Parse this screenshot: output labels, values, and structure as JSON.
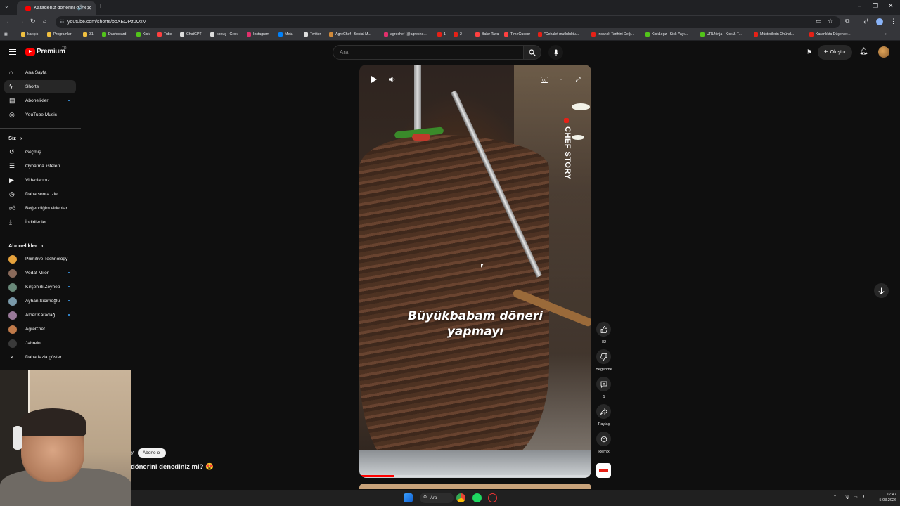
{
  "browser": {
    "tab_title": "Karadeniz dönerini denedin",
    "url": "youtube.com/shorts/boXEOPz0OxM",
    "bookmarks": [
      "karışık",
      "Programlar",
      "31",
      "Dashboard",
      "Kick",
      "Tube",
      "ChatGPT",
      "konuş - Grok",
      "Instagram",
      "Meta",
      "Twitter",
      "AgreChef - Social M...",
      "agrechef (@agreche...",
      "1",
      "2",
      "Bakır Tava",
      "TimeGuessr",
      "\"Cehalet mutluluktu...",
      "İnsanlık Tarihini Değ...",
      "KickLogz - Kick Yayı...",
      "URLNinja - Kick & T...",
      "Müşterilerin Önünd...",
      "Karanlıkta Düşenler..."
    ]
  },
  "youtube": {
    "logo_text": "Premium",
    "country_code": "TR",
    "search_placeholder": "Ara",
    "create_label": "Oluştur"
  },
  "sidebar": {
    "main": [
      {
        "label": "Ana Sayfa",
        "icon": "home-icon"
      },
      {
        "label": "Shorts",
        "icon": "shorts-icon"
      },
      {
        "label": "Abonelikler",
        "icon": "subscriptions-icon"
      },
      {
        "label": "YouTube Music",
        "icon": "music-icon"
      }
    ],
    "you_title": "Siz",
    "you": [
      {
        "label": "Geçmiş",
        "icon": "history-icon"
      },
      {
        "label": "Oynatma listeleri",
        "icon": "playlist-icon"
      },
      {
        "label": "Videolarınız",
        "icon": "your-videos-icon"
      },
      {
        "label": "Daha sonra izle",
        "icon": "watch-later-icon"
      },
      {
        "label": "Beğendiğim videolar",
        "icon": "liked-icon"
      },
      {
        "label": "İndirilenler",
        "icon": "download-icon"
      }
    ],
    "subs_title": "Abonelikler",
    "subs": [
      {
        "label": "Primitive Technology",
        "color": "#e6a23c"
      },
      {
        "label": "Vedat Milor",
        "color": "#8a6a5a"
      },
      {
        "label": "Kırşehirli Zeynep",
        "color": "#6a8a7a"
      },
      {
        "label": "Ayhan Sicimoğlu",
        "color": "#7a9aaa"
      },
      {
        "label": "Alper Karadağ",
        "color": "#9a7a9a"
      },
      {
        "label": "AgreChef",
        "color": "#c07a4a"
      },
      {
        "label": "Jahrein",
        "color": "#3a3a3a"
      }
    ],
    "show_more": "Daha fazla göster"
  },
  "video": {
    "watermark": "CHEF STORY",
    "caption_line1": "Büyükbabam döneri",
    "caption_line2": "yapmayı",
    "progress": 0.15
  },
  "actions": {
    "like_count": "82",
    "dislike_label": "Beğenme",
    "comment_count": "1",
    "share_label": "Paylaş",
    "remix_label": "Remix"
  },
  "channel": {
    "name_fragment": "ry",
    "subscribe_label": "Abone ol",
    "title_fragment": "dönerini denediniz mi? 😍"
  },
  "taskbar": {
    "search_label": "Ara",
    "time": "17:47",
    "date": "5.03.2026"
  }
}
